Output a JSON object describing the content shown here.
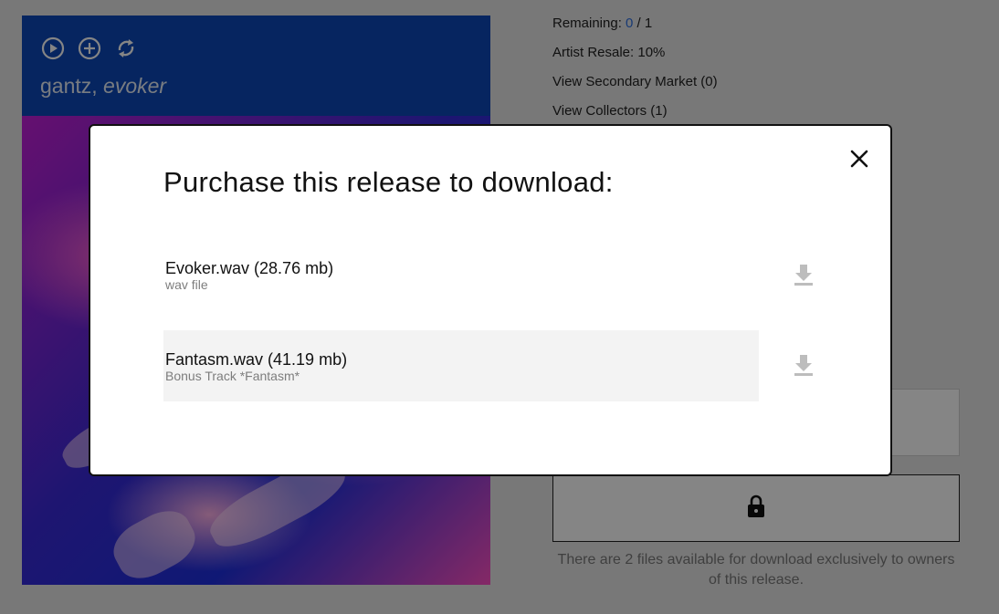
{
  "release": {
    "artist": "gantz,",
    "title": "evoker"
  },
  "info": {
    "remaining_label": "Remaining: ",
    "remaining_count": "0",
    "remaining_total": " / 1",
    "artist_resale": "Artist Resale: 10%",
    "secondary_market": "View Secondary Market (0)",
    "collectors": "View Collectors (1)"
  },
  "download_note": "There are 2 files available for download exclusively to owners of this release.",
  "modal": {
    "title": "Purchase this release to download:",
    "files": [
      {
        "name": "Evoker.wav (28.76 mb)",
        "desc": "wav file"
      },
      {
        "name": "Fantasm.wav (41.19 mb)",
        "desc": "Bonus Track *Fantasm*"
      }
    ]
  },
  "colors": {
    "accent_link": "#2f6fe0",
    "card_header": "#0d47b8",
    "overlay": "rgba(0,0,0,0.48)"
  },
  "icons": [
    "play-icon",
    "add-icon",
    "refresh-icon",
    "close-icon",
    "download-icon",
    "lock-icon"
  ]
}
